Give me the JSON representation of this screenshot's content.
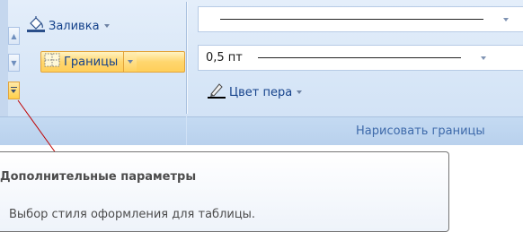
{
  "ribbon": {
    "shading_label": "Заливка",
    "borders_label": "Границы",
    "line_weight": "0,5 пт",
    "pen_color_label": "Цвет пера",
    "group_label": "Нарисовать границы",
    "colors": {
      "highlight": "#ffd04a",
      "label": "#15428b",
      "group_label": "#3e6aaa",
      "pointer": "#c00000"
    }
  },
  "tooltip": {
    "title": "Дополнительные параметры",
    "description": "Выбор стиля оформления для таблицы."
  }
}
